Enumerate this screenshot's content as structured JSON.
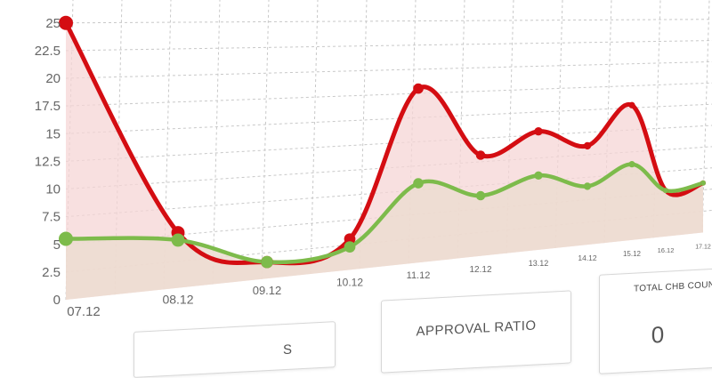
{
  "chart_data": {
    "type": "line",
    "categories": [
      "07.12",
      "08.12",
      "09.12",
      "10.12",
      "11.12",
      "12.12",
      "13.12",
      "14.12",
      "15.12",
      "16.12",
      "17.12"
    ],
    "series": [
      {
        "values": [
          25,
          5.2,
          1.6,
          3.1,
          18,
          10.7,
          12.9,
          11,
          15.3,
          5.3,
          5.8
        ],
        "color": "#d40d12"
      },
      {
        "values": [
          5.5,
          4.5,
          1.6,
          2.3,
          8.2,
          6.4,
          8.1,
          6.5,
          8.6,
          5.3,
          5.8
        ],
        "color": "#7dbb4b"
      }
    ],
    "y_ticks": [
      "0",
      "2.5",
      "5",
      "7.5",
      "10",
      "12.5",
      "15",
      "17.5",
      "20",
      "22.5",
      "25"
    ],
    "ylim": [
      0,
      25
    ],
    "grid": true,
    "legend": "none"
  },
  "cards": {
    "left_partial_text": "S",
    "approval_ratio_label": "APPROVAL RATIO",
    "total_chb_label": "TOTAL CHB COUNT",
    "total_chb_value": "0"
  },
  "colors": {
    "red": "#d40d12",
    "green": "#7dbb4b",
    "red_fill": "#f6d6d6",
    "green_fill": "#ecdcd0",
    "grid": "#c8c8c8",
    "axis_text": "#666666"
  }
}
